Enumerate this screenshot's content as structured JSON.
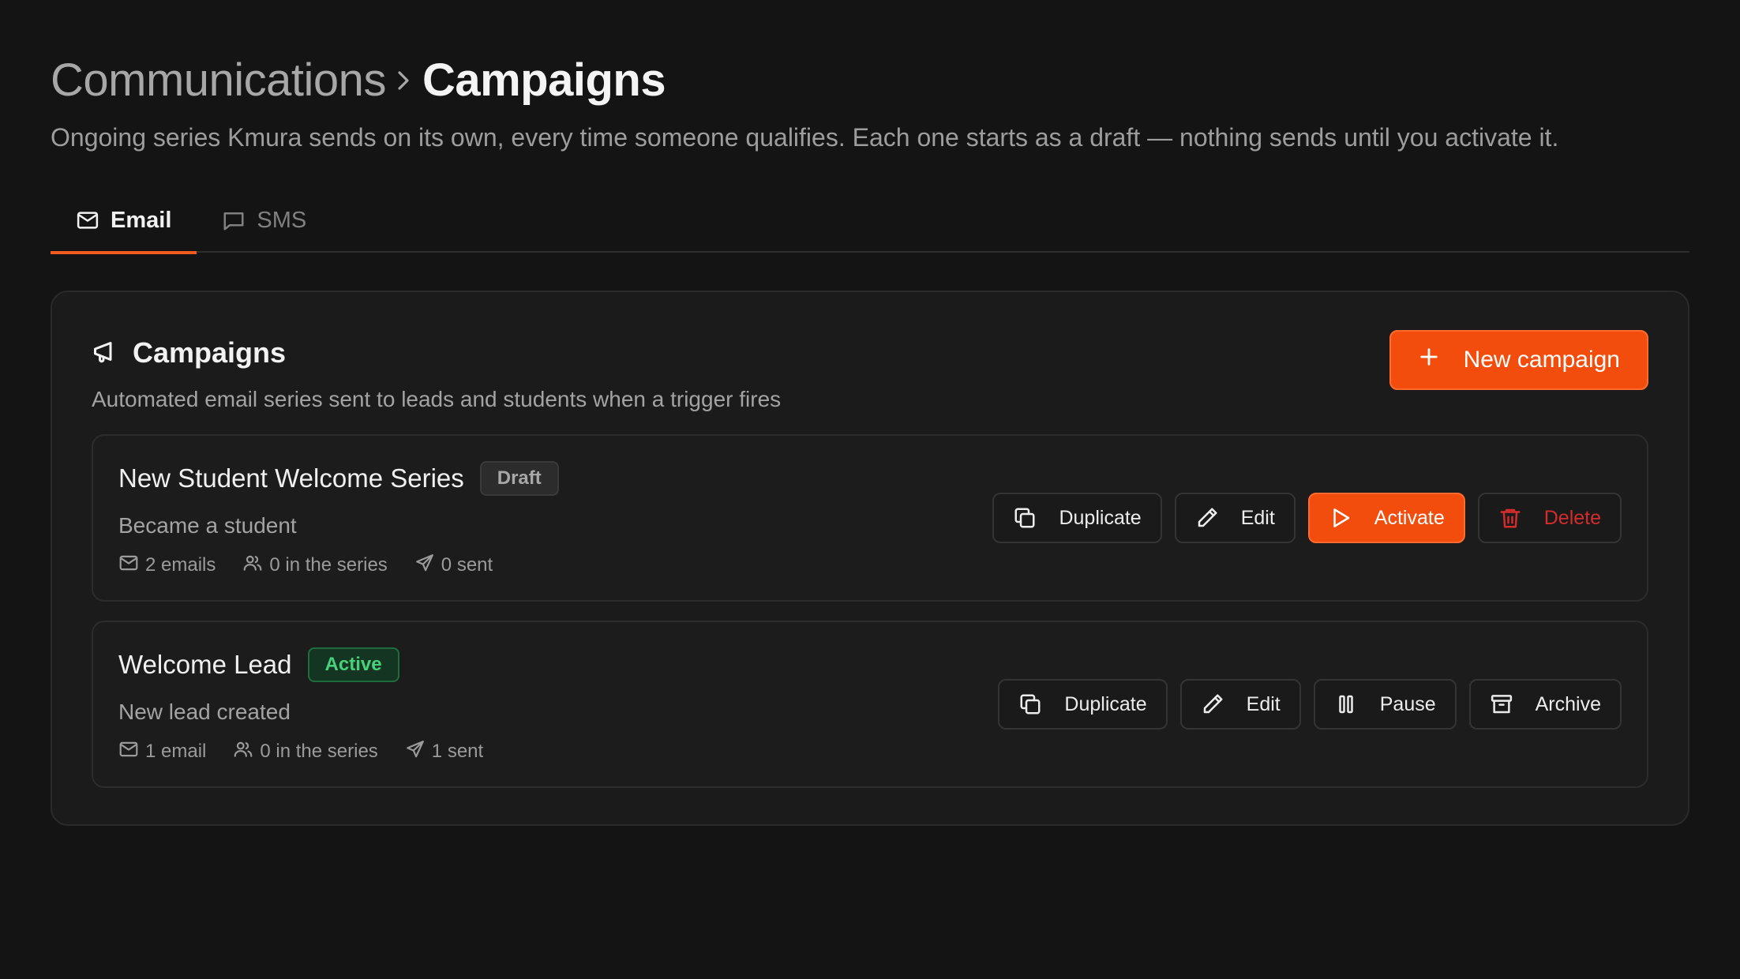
{
  "header": {
    "breadcrumb_parent": "Communications",
    "breadcrumb_current": "Campaigns",
    "subtitle": "Ongoing series Kmura sends on its own, every time someone qualifies. Each one starts as a draft — nothing sends until you activate it."
  },
  "tabs": [
    {
      "label": "Email",
      "icon": "mail-icon",
      "active": true
    },
    {
      "label": "SMS",
      "icon": "message-icon",
      "active": false
    }
  ],
  "card": {
    "title": "Campaigns",
    "icon": "megaphone-icon",
    "description": "Automated email series sent to leads and students when a trigger fires",
    "new_button_label": "New campaign"
  },
  "campaigns": [
    {
      "title": "New Student Welcome Series",
      "status": "Draft",
      "trigger": "Became a student",
      "emails": "2 emails",
      "in_series": "0 in the series",
      "sent": "0 sent",
      "actions": {
        "duplicate": "Duplicate",
        "edit": "Edit",
        "primary": "Activate",
        "secondary": "Delete"
      }
    },
    {
      "title": "Welcome Lead",
      "status": "Active",
      "trigger": "New lead created",
      "emails": "1 email",
      "in_series": "0 in the series",
      "sent": "1 sent",
      "actions": {
        "duplicate": "Duplicate",
        "edit": "Edit",
        "primary": "Pause",
        "secondary": "Archive"
      }
    }
  ],
  "colors": {
    "accent": "#f24d0d",
    "background": "#141414",
    "card": "#1b1b1b",
    "active_badge": "#46d17a",
    "danger": "#d22c2c"
  }
}
